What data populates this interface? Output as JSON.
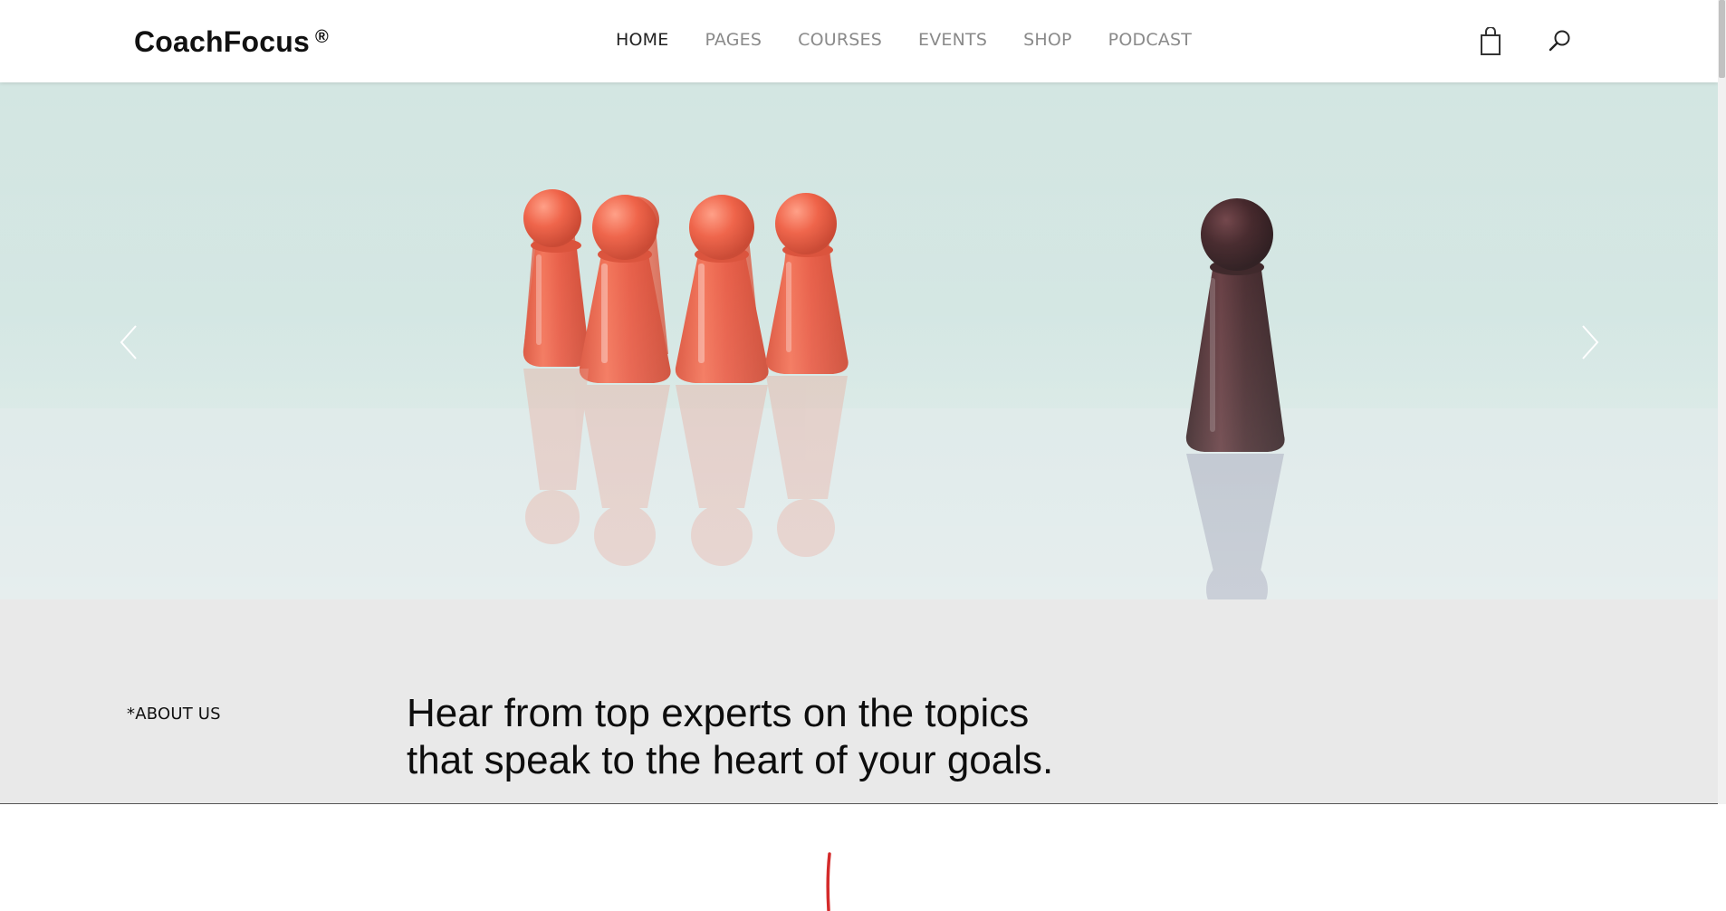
{
  "header": {
    "logo_text": "CoachFocus",
    "logo_mark": "®",
    "nav": [
      {
        "label": "HOME",
        "active": true
      },
      {
        "label": "PAGES",
        "active": false
      },
      {
        "label": "COURSES",
        "active": false
      },
      {
        "label": "EVENTS",
        "active": false
      },
      {
        "label": "SHOP",
        "active": false
      },
      {
        "label": "PODCAST",
        "active": false
      }
    ],
    "icons": {
      "cart": "shopping-bag-icon",
      "search": "search-icon"
    }
  },
  "hero": {
    "icons": {
      "prev": "chevron-left-icon",
      "next": "chevron-right-icon"
    },
    "colors": {
      "background": "#d3e6e2",
      "pawn_red": "#e8543a",
      "pawn_dark": "#3a1f22"
    }
  },
  "about": {
    "label": "*ABOUT US",
    "heading_line1": "Hear from top experts on the topics",
    "heading_line2": "that speak to the heart of your goals."
  },
  "colors": {
    "accent_red": "#d42b2b",
    "nav_active": "#222222",
    "nav_inactive": "#8a8a8a",
    "section_bg": "#e9e9e9"
  }
}
